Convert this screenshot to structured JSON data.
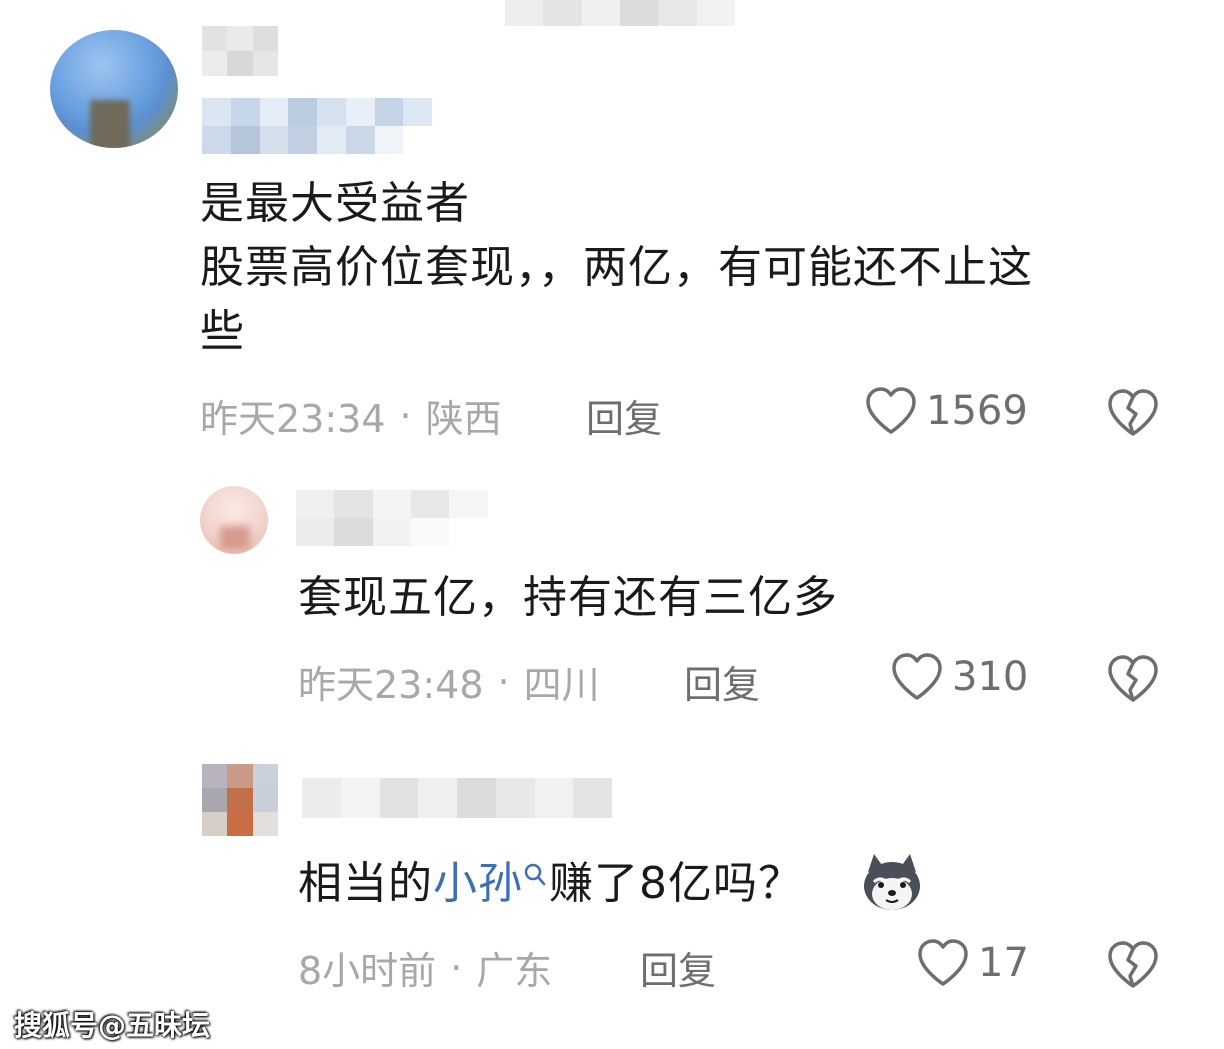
{
  "comments": [
    {
      "text_lines": [
        "是最大受益者",
        "股票高价位套现，，两亿，有可能还不止这",
        "些"
      ],
      "time": "昨天23:34",
      "separator": "·",
      "location": "陕西",
      "reply_label": "回复",
      "likes": "1569"
    },
    {
      "text": "套现五亿，持有还有三亿多",
      "time": "昨天23:48",
      "separator": "·",
      "location": "四川",
      "reply_label": "回复",
      "likes": "310"
    },
    {
      "text_before": "相当的",
      "mention": "小孙",
      "text_after": "赚了8亿吗？",
      "time": "8小时前",
      "separator": "·",
      "location": "广东",
      "reply_label": "回复",
      "likes": "17"
    }
  ],
  "watermark": "搜狐号@五昧坛",
  "icons": [
    "heart-outline-icon",
    "broken-heart-icon",
    "search-icon",
    "husky-emoji-icon"
  ],
  "colors": {
    "text": "#1a1a1a",
    "meta": "#a8a8a8",
    "action": "#6e6e6e",
    "mention": "#3b6fb6"
  }
}
